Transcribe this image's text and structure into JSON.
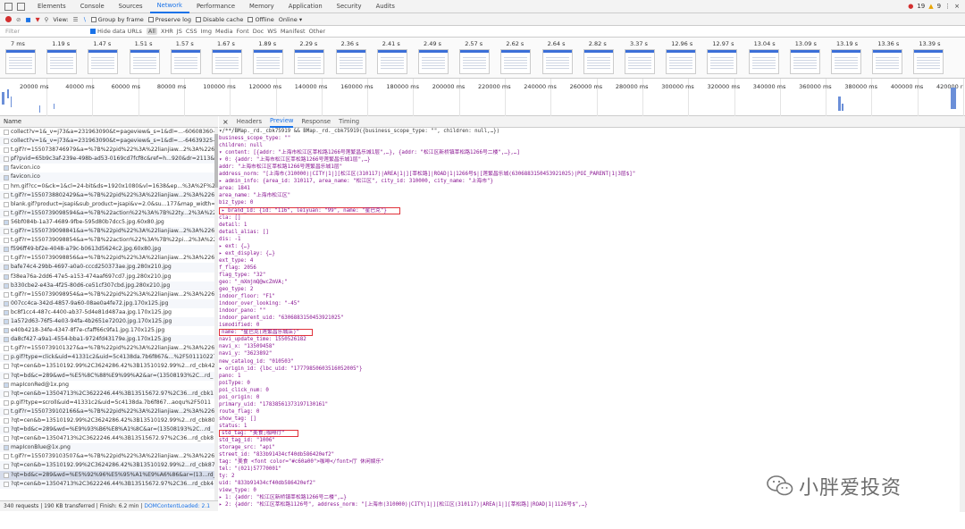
{
  "toolbar": {
    "tabs": [
      "Elements",
      "Console",
      "Sources",
      "Network",
      "Performance",
      "Memory",
      "Application",
      "Security",
      "Audits"
    ],
    "active_tab": "Network",
    "errors": "19",
    "warnings": "9"
  },
  "controls": {
    "view_label": "View:",
    "group_by_frame": "Group by frame",
    "preserve_log": "Preserve log",
    "disable_cache": "Disable cache",
    "offline": "Offline",
    "throttle": "Online"
  },
  "filter": {
    "placeholder": "Filter",
    "hide_data_urls": "Hide data URLs",
    "types": [
      "All",
      "XHR",
      "JS",
      "CSS",
      "Img",
      "Media",
      "Font",
      "Doc",
      "WS",
      "Manifest",
      "Other"
    ],
    "selected_type": "All"
  },
  "frames": {
    "times": [
      "7 ms",
      "1.19 s",
      "1.47 s",
      "1.51 s",
      "1.57 s",
      "1.67 s",
      "1.89 s",
      "2.29 s",
      "2.36 s",
      "2.41 s",
      "2.49 s",
      "2.57 s",
      "2.62 s",
      "2.64 s",
      "2.82 s",
      "3.37 s",
      "12.96 s",
      "12.97 s",
      "13.04 s",
      "13.09 s",
      "13.19 s",
      "13.36 s",
      "13.39 s"
    ]
  },
  "overview": {
    "ticks": [
      "20000 ms",
      "40000 ms",
      "60000 ms",
      "80000 ms",
      "100000 ms",
      "120000 ms",
      "140000 ms",
      "160000 ms",
      "180000 ms",
      "200000 ms",
      "220000 ms",
      "240000 ms",
      "260000 ms",
      "280000 ms",
      "300000 ms",
      "320000 ms",
      "340000 ms",
      "360000 ms",
      "380000 ms",
      "400000 ms",
      "420000 r"
    ]
  },
  "requests": {
    "header": "Name",
    "items": [
      "collect?v=1&_v=j73&a=231963090&t=pageview&_s=1&dl=...-60608360-",
      "collect?v=1&_v=j73&a=231963090&t=pageview&_s=1&dl=...-64639325-",
      "t.gif?r=1550738746979&a=%7B%22pid%22%3A%22lianjiaw...2%3A%226e",
      "pf?pvid=65b9c3af-239e-498b-ad53-0169cd7fcf8c&ref=h...920&dr=2113&",
      "favicon.ico",
      "favicon.ico",
      "hm.gif?cc=0&ck=1&cl=24-bit&ds=1920x1080&vl=1638&ep...%3A%2F%2",
      "t.gif?r=1550738802429&a=%7B%22pid%22%3A%22lianjiaw...2%3A%226e",
      "blank.gif?product=jsapi&sub_product=jsapi&v=2.0&su...177&map_width=",
      "t.gif?r=1550739098594&a=%7B%22action%22%3A%7B%22ty...2%3A%22(",
      "56bf084b-1a37-4689-9fbe-595d80b7dcc5.jpg.60x80.jpg",
      "t.gif?r=1550739098841&a=%7B%22pid%22%3A%22lianjiaw...2%3A%226e",
      "t.gif?r=1550739098854&a=%7B%22action%22%3A%7B%22pi...2%3A%22(",
      "f596ff49-bf2e-4048-a79c-b0613d5624c2.jpg.60x80.jpg",
      "t.gif?r=1550739098856&a=%7B%22pid%22%3A%22lianjiaw...2%3A%226e",
      "bafe74c4-29bb-4697-a0a0-cccd250373ae.jpg.280x210.jpg",
      "f38ea76a-2dd6-47e5-a153-474aaf697cd7.jpg.280x210.jpg",
      "b330cbe2-e43a-4f25-80d6-ce51cf307cbd.jpg.280x210.jpg",
      "t.gif?r=1550739098954&a=%7B%22pid%22%3A%22lianjiaw...2%3A%226e",
      "007cc4ca-342d-4857-9a60-08ae0a4fe72.jpg.170x125.jpg",
      "bc8f1cc4-487c-4400-ab37-5d4e81d487aa.jpg.170x125.jpg",
      "1a572d63-76f5-4e03-94fa-4b2651e72020.jpg.170x125.jpg",
      "e40b4218-34fe-4347-8f7e-cfaff66c9fa1.jpg.170x125.jpg",
      "da8cf427-a9a1-4554-bba1-9724fd43179e.jpg.170x125.jpg",
      "t.gif?r=1550739101327&a=%7B%22pid%22%3A%22lianjiaw...2%3A%226e",
      "p.gif?type=click&uid=41331c2&uid=5c4138da.7b6f867&...%2F501110227",
      "?qt=cen&b=13510192.99%2C3624286.42%3B13510192.99%2...rd_cbk42",
      "?qt=bd&c=289&wd=%E5%8C%88%E9%99%A2&ar=(13508193%2C...rd_",
      "mapIconRed@1x.png",
      "?qt=cen&b=13504713%2C3622246.44%3B13515672.97%2C36...rd_cbk1",
      "p.gif?type=scroll&uid=41331c2&uid=5c4138da.7b6f867...aoqu%2F5011",
      "t.gif?r=1550739102166&a=%7B%22pid%22%3A%22lianjiaw...2%3A%226e",
      "?qt=cen&b=13510192.99%2C3624286.42%3B13510192.99%2...rd_cbk80",
      "?qt=bd&c=289&wd=%E9%93%B6%E8%A1%8C&ar=(13508193%2C...rd_",
      "?qt=cen&b=13504713%2C3622246.44%3B13515672.97%2C36...rd_cbk8",
      "mapIconBlue@1x.png",
      "t.gif?r=1550739103507&a=%7B%22pid%22%3A%22lianjiaw...2%3A%226e",
      "?qt=cen&b=13510192.99%2C3624286.42%3B13510192.99%2...rd_cbk87",
      "?qt=bd&c=289&wd=%E5%92%96%E5%95%A1%E9%A6%86&ar=(13...rd_",
      "?qt=cen&b=13504713%2C3622246.44%3B13515672.97%2C36...rd_cbk4"
    ],
    "selected_index": 38
  },
  "statusbar": {
    "summary": "340 requests | 190 KB transferred | Finish: 6.2 min |",
    "dcl": "DOMContentLoaded: 2.1"
  },
  "detail_tabs": {
    "close": "×",
    "tabs": [
      "Headers",
      "Preview",
      "Response",
      "Timing"
    ],
    "active": "Preview"
  },
  "preview": {
    "lines": [
      "▾/**/BMap._rd._cbk75919 && BMap._rd._cbk75919({business_scope_type: \"\", children: null,…})",
      "   business_scope_type: \"\"",
      "   children: null",
      " ▾ content: [{addr: \"上海市松江区莘松路1266号莲繁昌乐城1层\",…}, {addr: \"松江区新桥镇莘松路1266号二楼\",…},…]",
      "   ▾ 0: {addr: \"上海市松江区莘松路1266号莲繁昌乐城1层\",…}",
      "       addr: \"上海市松江区莘松路1266号莲繁昌乐城1层\"",
      "       address_norm: \"[上海市(310000)|CITY|1|][松江区(310117)|AREA|1|][莘松路]|ROAD|1|1266号$|[莲繁昌乐城(6306883150453921025)|POI_PARENT|1|3层$]\"",
      "     ▸ admin_info: {area_id: 310117, area_name: \"松江区\", city_id: 310000, city_name: \"上海市\"}",
      "       area: 1841",
      "       area_name: \"上海市松江区\"",
      "       biz_type: 0",
      "     ▸ brand_id: {id: \"116\", leiyuan: \"99\", name: \"星巴克\"}",
      "       cla: []",
      "       detail: 1",
      "       detail_alias: []",
      "       dis: -1",
      "     ▸ ext: {…}",
      "     ▸ ext_display: {…}",
      "       ext_type: 4",
      "       f_flag: 2056",
      "       flag_type: \"32\"",
      "       geo: \"_mXmjmQ@wcZmVA;\"",
      "       geo_type: 2",
      "       indoor_floor: \"F1\"",
      "       indoor_over_looking: \"-45\"",
      "       indoor_pano: \"\"",
      "       indoor_parent_uid: \"6306883150453921025\"",
      "       ismodified: 0",
      "       name: \"星巴克(莲繁昌乐城店)\"",
      "       navi_update_time: 1550526182",
      "       navi_x: \"13509458\"",
      "       navi_y: \"3623892\"",
      "       new_catalog_id: \"010503\"",
      "     ▸ origin_id: {lbc_uid: \"17779850603516052005\"}",
      "       pano: 1",
      "       poiType: 0",
      "       poi_click_num: 0",
      "       poi_origin: 0",
      "       primary_uid: \"17838561373197130161\"",
      "       route_flag: 0",
      "       show_tag: []",
      "       status: 1",
      "       std_tag: \"美食;咖啡厅\"",
      "       std_tag_id: \"1006\"",
      "       storage_src: \"api\"",
      "       street_id: \"833b91434cf40db586420ef2\"",
      "       tag: \"美食 <font color=\"#c60a00\">咖啡</font>厅 休闲娱乐\"",
      "       tel: \"(021)57770001\"",
      "       ty: 2",
      "       uid: \"833b91434cf40db586420ef2\"",
      "       view_type: 0",
      "   ▸ 1: {addr: \"松江区新桥镇莘松路1266号二楼\",…}",
      "   ▸ 2: {addr: \"松江区莘松路1126号\", address_norm: \"[上海市(310000)|CITY|1|][松江区(310117)|AREA|1|][莘松路]|ROAD|1|1126号$\",…}"
    ],
    "highlights": [
      11,
      28,
      42
    ]
  },
  "watermark": {
    "text": "小胖爱投资"
  }
}
